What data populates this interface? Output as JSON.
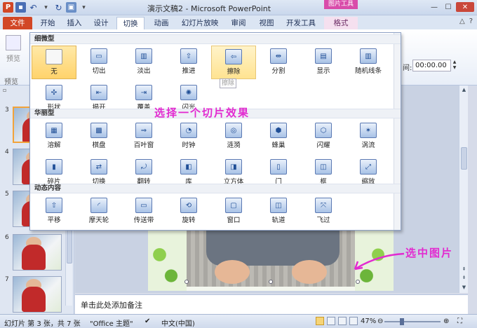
{
  "window": {
    "title": "演示文稿2 - Microsoft PowerPoint",
    "context_header": "图片工具"
  },
  "tabs": [
    "文件",
    "开始",
    "插入",
    "设计",
    "切换",
    "动画",
    "幻灯片放映",
    "审阅",
    "视图",
    "开发工具",
    "格式"
  ],
  "active_tab": "切换",
  "ribbon": {
    "preview_label": "预览",
    "preview_group_label": "预览",
    "time_label": "间:",
    "time_value": "00:00.00"
  },
  "gallery": {
    "sections": [
      {
        "title": "细微型",
        "items": [
          {
            "label": "无",
            "icon": "none-icon",
            "state": "selected"
          },
          {
            "label": "切出",
            "icon": "cut-icon"
          },
          {
            "label": "淡出",
            "icon": "fade-icon"
          },
          {
            "label": "推进",
            "icon": "push-icon"
          },
          {
            "label": "擦除",
            "icon": "wipe-icon",
            "state": "hovered"
          },
          {
            "label": "分割",
            "icon": "split-icon"
          },
          {
            "label": "显示",
            "icon": "reveal-icon"
          },
          {
            "label": "随机线条",
            "icon": "random-bars-icon"
          },
          {
            "label": "形状",
            "icon": "shape-icon"
          },
          {
            "label": "揭开",
            "icon": "uncover-icon"
          },
          {
            "label": "覆盖",
            "icon": "cover-icon"
          },
          {
            "label": "闪光",
            "icon": "flash-icon"
          }
        ]
      },
      {
        "title": "华丽型",
        "items": [
          {
            "label": "溶解",
            "icon": "dissolve-icon"
          },
          {
            "label": "棋盘",
            "icon": "checkerboard-icon"
          },
          {
            "label": "百叶窗",
            "icon": "blinds-icon"
          },
          {
            "label": "时钟",
            "icon": "clock-icon"
          },
          {
            "label": "涟漪",
            "icon": "ripple-icon"
          },
          {
            "label": "蜂巢",
            "icon": "honeycomb-icon"
          },
          {
            "label": "闪耀",
            "icon": "glitter-icon"
          },
          {
            "label": "涡流",
            "icon": "vortex-icon"
          },
          {
            "label": "碎片",
            "icon": "shred-icon"
          },
          {
            "label": "切换",
            "icon": "switch-icon"
          },
          {
            "label": "翻转",
            "icon": "flip-icon"
          },
          {
            "label": "库",
            "icon": "gallery-icon"
          },
          {
            "label": "立方体",
            "icon": "cube-icon"
          },
          {
            "label": "门",
            "icon": "doors-icon"
          },
          {
            "label": "框",
            "icon": "box-icon"
          },
          {
            "label": "缩放",
            "icon": "zoom-icon"
          }
        ]
      },
      {
        "title": "动态内容",
        "items": [
          {
            "label": "平移",
            "icon": "pan-icon"
          },
          {
            "label": "摩天轮",
            "icon": "ferris-wheel-icon"
          },
          {
            "label": "传送带",
            "icon": "conveyor-icon"
          },
          {
            "label": "旋转",
            "icon": "rotate-icon"
          },
          {
            "label": "窗口",
            "icon": "window-icon"
          },
          {
            "label": "轨道",
            "icon": "orbit-icon"
          },
          {
            "label": "飞过",
            "icon": "fly-through-icon"
          }
        ]
      }
    ],
    "tooltip": "擦除"
  },
  "slides": {
    "numbers": [
      "3",
      "4",
      "5",
      "6",
      "7"
    ]
  },
  "notes_placeholder": "单击此处添加备注",
  "status": {
    "slide_info": "幻灯片 第 3 张，共 7 张",
    "theme": "\"Office 主题\"",
    "language": "中文(中国)",
    "zoom": "47%"
  },
  "annotations": {
    "choose_transition": "选择一个切片效果",
    "select_picture": "选中图片"
  },
  "colors": {
    "file_tab": "#d24726",
    "annotation": "#e22bd0",
    "selected_item": "#ffd36b",
    "context_tab": "#d94caa"
  }
}
